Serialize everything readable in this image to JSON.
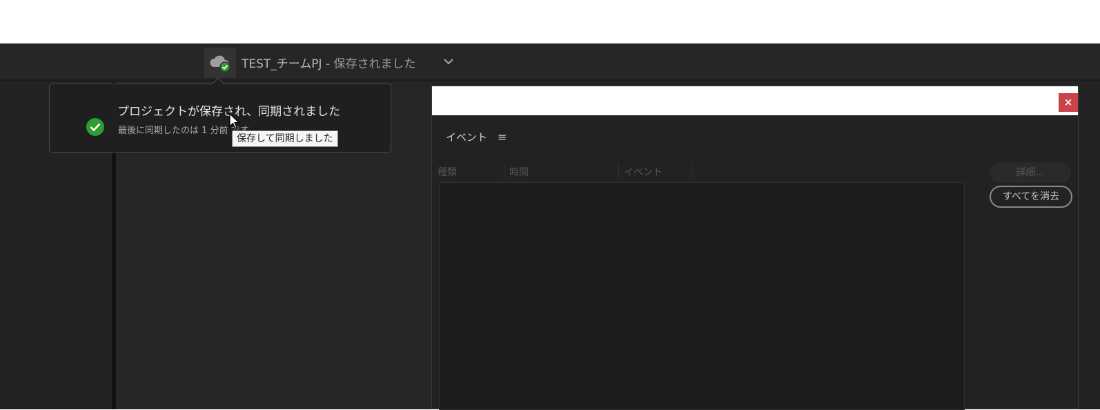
{
  "header": {
    "project_name": "TEST_チームPJ",
    "status_suffix": " - 保存されました",
    "cloud_icon": "cloud-check-icon",
    "dropdown_icon": "chevron-down-icon"
  },
  "tooltip": {
    "text": "保存して同期しました"
  },
  "popover": {
    "title": "プロジェクトが保存され、同期されました",
    "subtitle": "最後に同期したのは 1 分前 です。",
    "icon": "check-circle-icon"
  },
  "dialog": {
    "close_label": "×",
    "panel_title": "イベント",
    "menu_icon": "≡",
    "columns": [
      "種類",
      "時間",
      "イベント"
    ],
    "details_button": "詳細...",
    "clear_all_button": "すべてを消去"
  },
  "colors": {
    "accent_green": "#2d9d34",
    "close_red": "#c9434a",
    "background": "#232323"
  }
}
